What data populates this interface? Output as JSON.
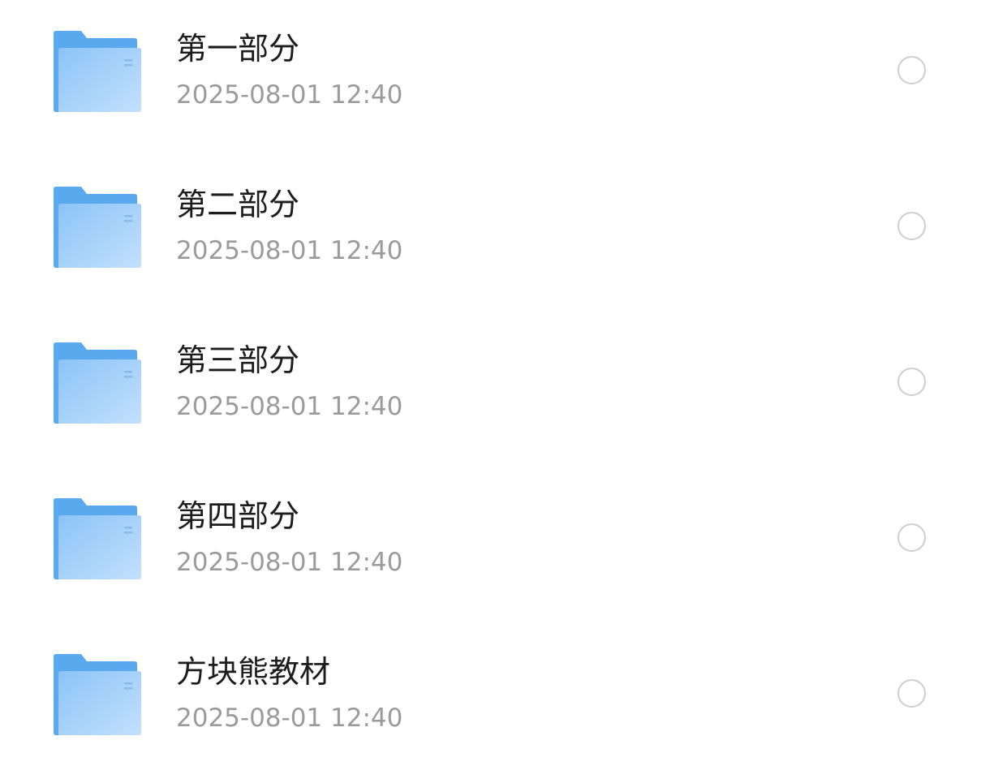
{
  "files": [
    {
      "name": "第一部分",
      "modified": "2025-08-01 12:40",
      "selected": false,
      "icon": "folder-icon"
    },
    {
      "name": "第二部分",
      "modified": "2025-08-01 12:40",
      "selected": false,
      "icon": "folder-icon"
    },
    {
      "name": "第三部分",
      "modified": "2025-08-01 12:40",
      "selected": false,
      "icon": "folder-icon"
    },
    {
      "name": "第四部分",
      "modified": "2025-08-01 12:40",
      "selected": false,
      "icon": "folder-icon"
    },
    {
      "name": "方块熊教材",
      "modified": "2025-08-01 12:40",
      "selected": false,
      "icon": "folder-icon"
    }
  ],
  "colors": {
    "folder_back": "#5aa9ee",
    "folder_front_top": "#8cc4f7",
    "folder_front_bottom": "#c2e0fc",
    "name_text": "#1c1c1c",
    "meta_text": "#9b9b9b",
    "circle_border": "#cfcfcf"
  }
}
